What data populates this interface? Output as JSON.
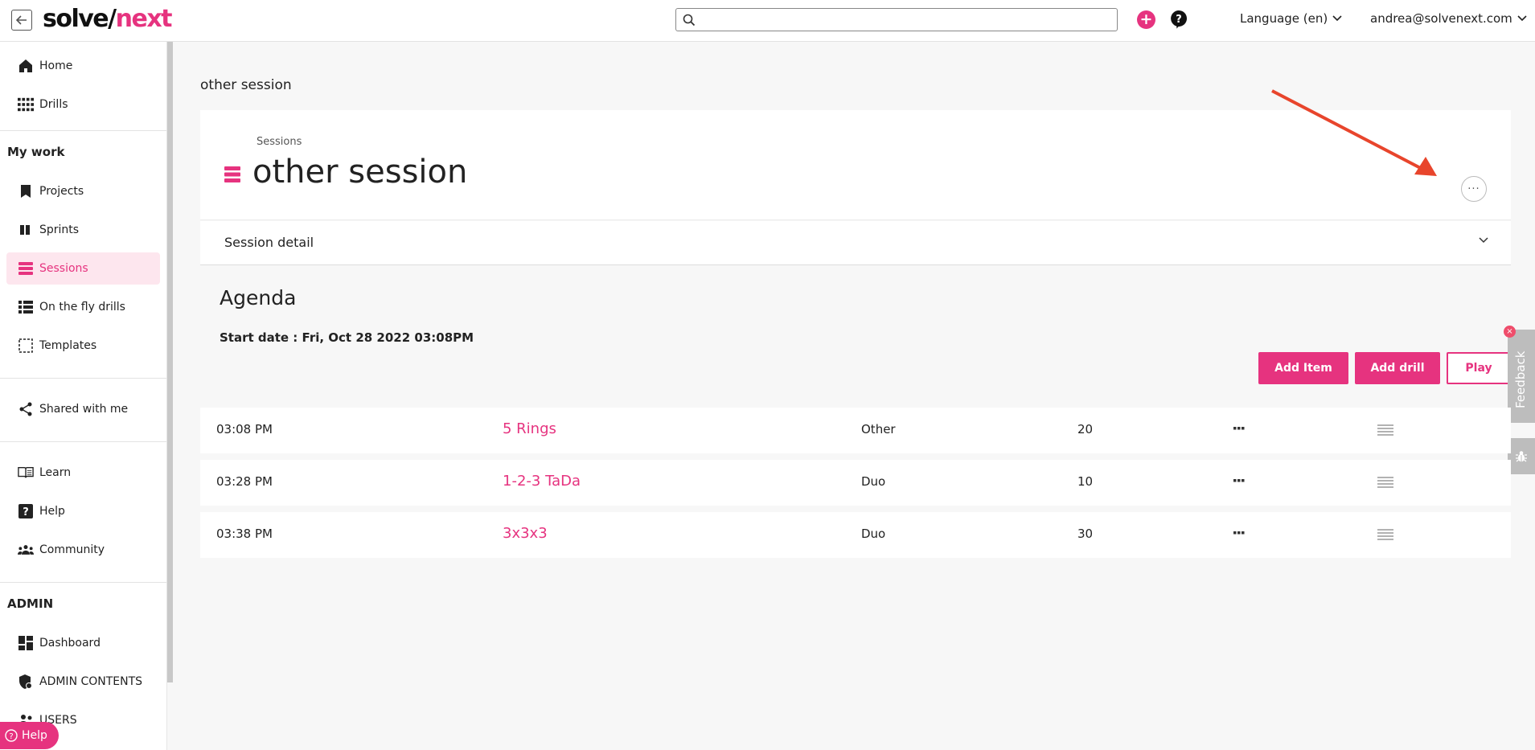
{
  "header": {
    "logo_part1": "solve/",
    "logo_part2": "next",
    "search_placeholder": "",
    "language": "Language (en)",
    "user_email": "andrea@solvenext.com"
  },
  "sidebar": {
    "top_items": [
      {
        "label": "Home",
        "icon": "home-icon"
      },
      {
        "label": "Drills",
        "icon": "grid-icon"
      }
    ],
    "my_work_title": "My work",
    "my_work_items": [
      {
        "label": "Projects",
        "icon": "bookmark-icon"
      },
      {
        "label": "Sprints",
        "icon": "columns-icon"
      },
      {
        "label": "Sessions",
        "icon": "sessions-icon",
        "active": true
      },
      {
        "label": "On the fly drills",
        "icon": "list-icon"
      },
      {
        "label": "Templates",
        "icon": "template-icon"
      }
    ],
    "shared_items": [
      {
        "label": "Shared with me",
        "icon": "share-icon"
      }
    ],
    "support_items": [
      {
        "label": "Learn",
        "icon": "book-icon"
      },
      {
        "label": "Help",
        "icon": "question-icon"
      },
      {
        "label": "Community",
        "icon": "people-icon"
      }
    ],
    "admin_title": "ADMIN",
    "admin_items": [
      {
        "label": "Dashboard",
        "icon": "dashboard-icon"
      },
      {
        "label": "ADMIN CONTENTS",
        "icon": "shield-icon"
      },
      {
        "label": "USERS",
        "icon": "users-icon"
      }
    ],
    "help_fab": "Help"
  },
  "main": {
    "page_title": "other session",
    "breadcrumb": "Sessions",
    "session_title": "other session",
    "session_detail_label": "Session detail",
    "agenda_title": "Agenda",
    "start_date": "Start date : Fri, Oct 28 2022 03:08PM",
    "buttons": {
      "add_item": "Add Item",
      "add_drill": "Add drill",
      "play": "Play"
    },
    "agenda_rows": [
      {
        "time": "03:08 PM",
        "name": "5 Rings",
        "type": "Other",
        "duration": "20"
      },
      {
        "time": "03:28 PM",
        "name": "1-2-3 TaDa",
        "type": "Duo",
        "duration": "10"
      },
      {
        "time": "03:38 PM",
        "name": "3x3x3",
        "type": "Duo",
        "duration": "30"
      }
    ]
  },
  "feedback": {
    "label": "Feedback",
    "badge": "×"
  },
  "colors": {
    "accent": "#e6337f",
    "annotation_arrow": "#e8452c"
  }
}
